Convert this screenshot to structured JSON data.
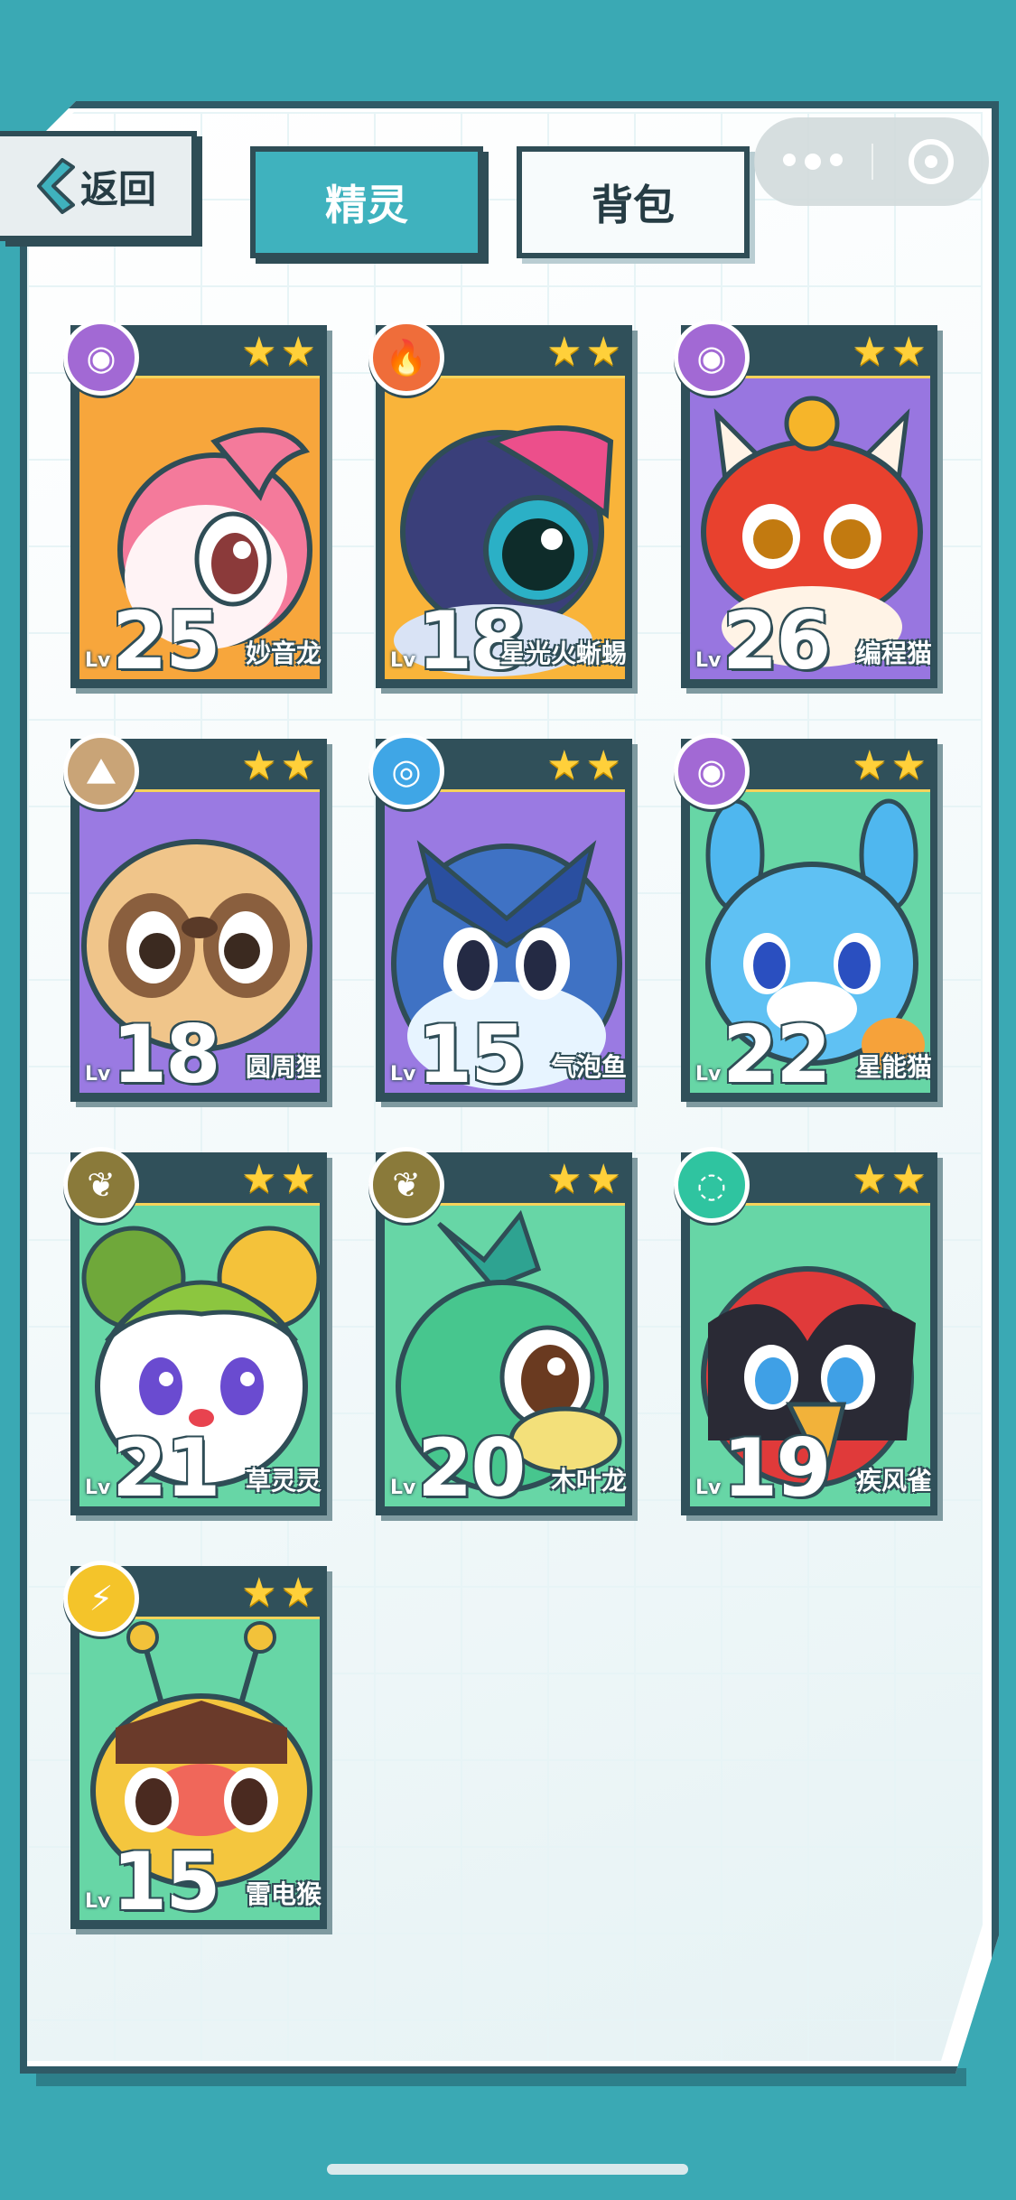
{
  "header": {
    "back_label": "返回",
    "tabs": [
      {
        "label": "精灵",
        "active": true
      },
      {
        "label": "背包",
        "active": false
      }
    ]
  },
  "cards": [
    {
      "name": "妙音龙",
      "level": "25",
      "lv_label": "Lv",
      "stars": 2,
      "type_icon": "psychic-eye-icon",
      "type_color": "#a269d4",
      "bg": "#f7a63c"
    },
    {
      "name": "星光火蜥蜴",
      "level": "18",
      "lv_label": "Lv",
      "stars": 2,
      "type_icon": "fire-icon",
      "type_color": "#ef6d3a",
      "bg": "#f9b43a"
    },
    {
      "name": "编程猫",
      "level": "26",
      "lv_label": "Lv",
      "stars": 2,
      "type_icon": "psychic-eye-icon",
      "type_color": "#a269d4",
      "bg": "#9876e0"
    },
    {
      "name": "圆周狸",
      "level": "18",
      "lv_label": "Lv",
      "stars": 2,
      "type_icon": "rock-icon",
      "type_color": "#c9a477",
      "bg": "#9a7ae2"
    },
    {
      "name": "气泡鱼",
      "level": "15",
      "lv_label": "Lv",
      "stars": 2,
      "type_icon": "water-icon",
      "type_color": "#3fa6e6",
      "bg": "#9a7ae2"
    },
    {
      "name": "星能猫",
      "level": "22",
      "lv_label": "Lv",
      "stars": 2,
      "type_icon": "psychic-eye-icon",
      "type_color": "#a269d4",
      "bg": "#67d6a6"
    },
    {
      "name": "草灵灵",
      "level": "21",
      "lv_label": "Lv",
      "stars": 2,
      "type_icon": "leaf-icon",
      "type_color": "#8a7a3a",
      "bg": "#67d6a6"
    },
    {
      "name": "木叶龙",
      "level": "20",
      "lv_label": "Lv",
      "stars": 2,
      "type_icon": "leaf-icon",
      "type_color": "#8a7a3a",
      "bg": "#67d6a6"
    },
    {
      "name": "疾风雀",
      "level": "19",
      "lv_label": "Lv",
      "stars": 2,
      "type_icon": "wind-icon",
      "type_color": "#2fc4a0",
      "bg": "#67d6a6"
    },
    {
      "name": "雷电猴",
      "level": "15",
      "lv_label": "Lv",
      "stars": 2,
      "type_icon": "lightning-icon",
      "type_color": "#f4c42a",
      "bg": "#67d6a6"
    }
  ],
  "colors": {
    "background": "#3aa9b4",
    "accent": "#3fb2be",
    "dark": "#2f4d56"
  }
}
